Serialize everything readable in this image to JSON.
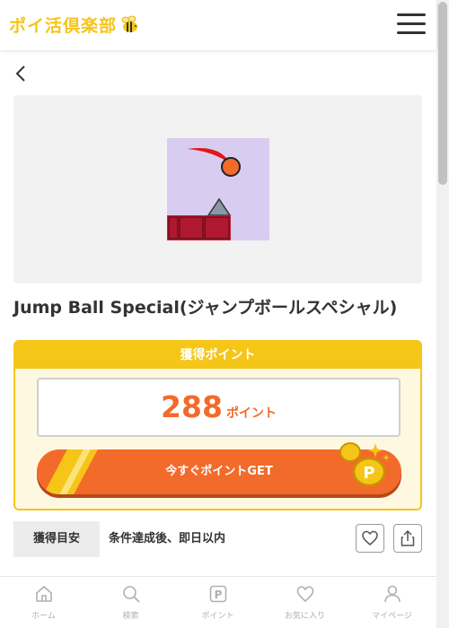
{
  "header": {
    "logo_text": "ポイ活倶楽部"
  },
  "game": {
    "title": "Jump Ball Special(ジャンプボールスペシャル)"
  },
  "points": {
    "heading": "獲得ポイント",
    "value": "288",
    "unit": "ポイント",
    "get_button_label": "今すぐポイントGET"
  },
  "criteria": {
    "label": "獲得目安",
    "value": "条件達成後、即日以内"
  },
  "bottom_nav": {
    "items": [
      {
        "label": "ホーム",
        "icon": "home-icon"
      },
      {
        "label": "検索",
        "icon": "search-icon"
      },
      {
        "label": "ポイント",
        "icon": "point-icon"
      },
      {
        "label": "お気に入り",
        "icon": "heart-icon"
      },
      {
        "label": "マイページ",
        "icon": "user-icon"
      }
    ]
  },
  "colors": {
    "brand_yellow": "#f5c518",
    "accent_orange": "#f26b2a"
  }
}
